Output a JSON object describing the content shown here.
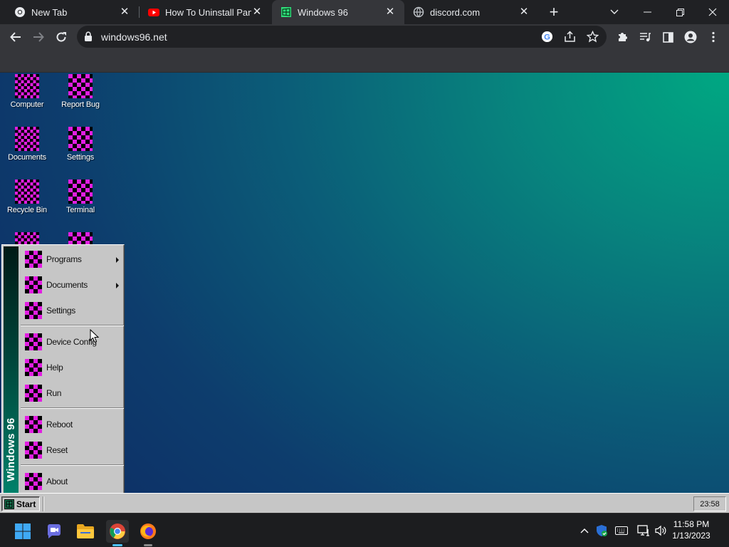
{
  "browser": {
    "tabs": [
      {
        "title": "New Tab",
        "favicon": "chrome-icon",
        "active": false
      },
      {
        "title": "How To Uninstall Panda",
        "favicon": "youtube-icon",
        "active": false
      },
      {
        "title": "Windows 96",
        "favicon": "windows96-icon",
        "active": true
      },
      {
        "title": "discord.com",
        "favicon": "globe-icon",
        "active": false
      }
    ],
    "new_tab_label": "+",
    "url": "windows96.net"
  },
  "desktop": {
    "icons": [
      {
        "label": "Computer"
      },
      {
        "label": "Report Bug"
      },
      {
        "label": "Documents"
      },
      {
        "label": "Settings"
      },
      {
        "label": "Recycle Bin"
      },
      {
        "label": "Terminal"
      }
    ]
  },
  "start_menu": {
    "side_label": "Windows 96",
    "items": [
      {
        "label": "Programs",
        "submenu": true
      },
      {
        "label": "Documents",
        "submenu": true
      },
      {
        "label": "Settings",
        "submenu": false
      },
      {
        "label": "Device Config",
        "submenu": false
      },
      {
        "label": "Help",
        "submenu": false
      },
      {
        "label": "Run",
        "submenu": false
      },
      {
        "label": "Reboot",
        "submenu": false
      },
      {
        "label": "Reset",
        "submenu": false
      },
      {
        "label": "About",
        "submenu": false
      }
    ]
  },
  "w96_taskbar": {
    "start_label": "Start",
    "clock": "23:58"
  },
  "os_taskbar": {
    "time": "11:58 PM",
    "date": "1/13/2023"
  },
  "colors": {
    "icon_magenta": "#e21ee2",
    "desktop_teal": "#00a882",
    "desktop_navy": "#0d2a64",
    "win96_gray": "#c6c6c6"
  }
}
